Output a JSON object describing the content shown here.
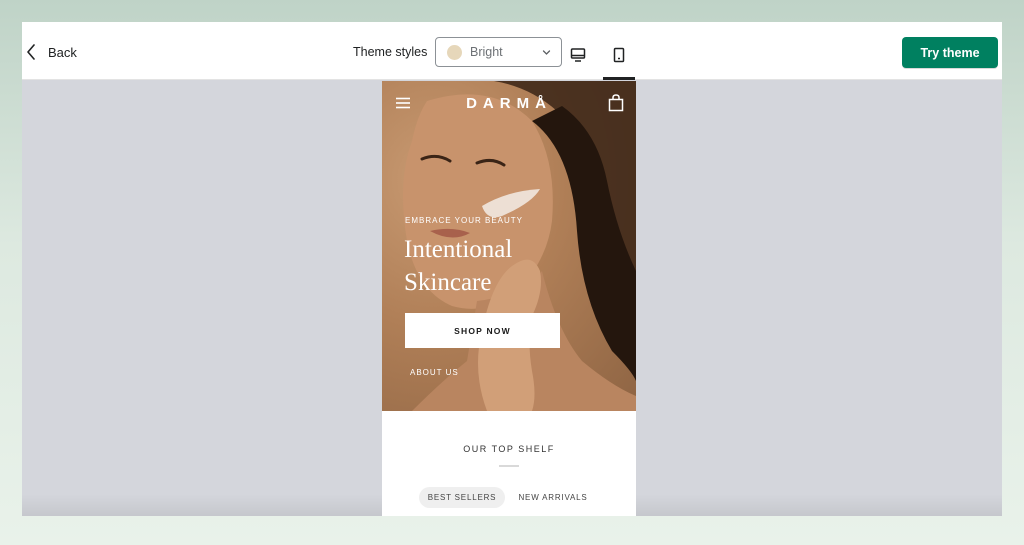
{
  "toolbar": {
    "back_label": "Back",
    "theme_styles_label": "Theme styles",
    "theme_select": {
      "value": "Bright",
      "swatch_color": "#e6d7ba"
    },
    "view_options": [
      "desktop-icon",
      "mobile-icon"
    ],
    "active_view": "mobile",
    "try_button_label": "Try theme",
    "accent_color": "#008060"
  },
  "preview": {
    "logo": "DARMÅ",
    "hero": {
      "eyebrow": "EMBRACE YOUR BEAUTY",
      "headline_line1": "Intentional",
      "headline_line2": "Skincare",
      "shop_button": "SHOP NOW",
      "about_link": "ABOUT US"
    },
    "shelf": {
      "title": "OUR TOP SHELF",
      "tabs": [
        "BEST SELLERS",
        "NEW ARRIVALS"
      ],
      "active_tab": "BEST SELLERS"
    }
  }
}
